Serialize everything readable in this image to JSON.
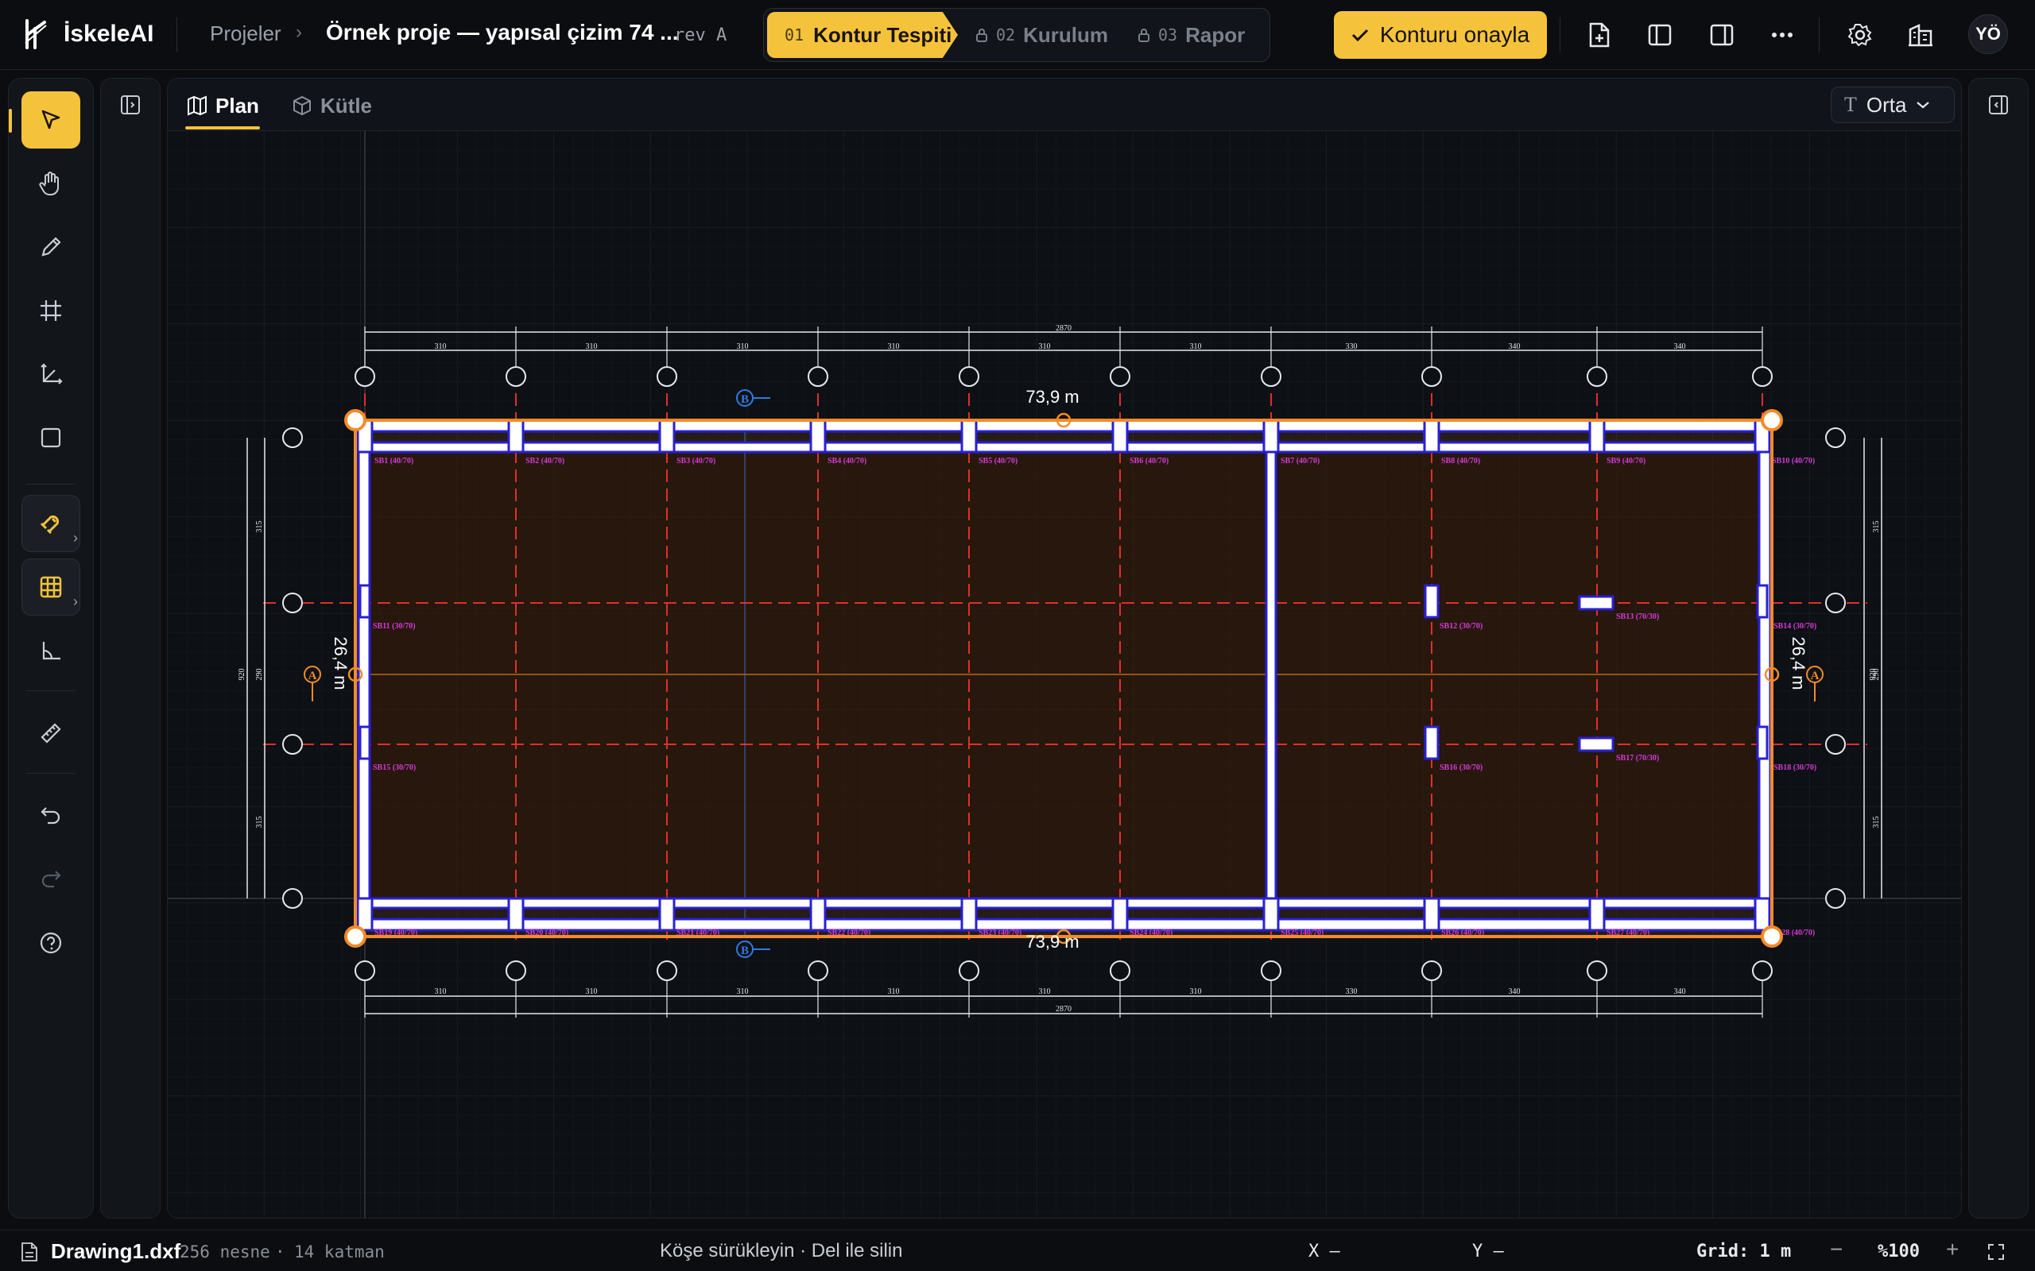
{
  "app": {
    "brand": "İskeleAI"
  },
  "breadcrumb": {
    "projects": "Projeler",
    "project_title": "Örnek proje — yapısal çizim 74 ...",
    "revision": "rev A"
  },
  "steps": [
    {
      "num": "01",
      "label": "Kontur Tespiti",
      "state": "active"
    },
    {
      "num": "02",
      "label": "Kurulum",
      "state": "locked"
    },
    {
      "num": "03",
      "label": "Rapor",
      "state": "locked"
    }
  ],
  "toolbar": {
    "confirm_label": "Konturu onayla",
    "avatar_initials": "YÖ"
  },
  "tabs": [
    {
      "label": "Plan",
      "icon": "map-icon",
      "active": true
    },
    {
      "label": "Kütle",
      "icon": "cube-icon",
      "active": false
    }
  ],
  "text_size": {
    "label": "Orta"
  },
  "drawing": {
    "dim_top": "73,9 m",
    "dim_bottom": "73,9 m",
    "dim_left": "26,4 m",
    "dim_right": "26,4 m",
    "section_b": "B",
    "section_a": "A",
    "overall_top": "2870",
    "overall_bottom": "2870",
    "spans_top": [
      "310",
      "310",
      "310",
      "310",
      "310",
      "310",
      "330",
      "340",
      "340"
    ],
    "spans_bottom": [
      "310",
      "310",
      "310",
      "310",
      "310",
      "310",
      "330",
      "340",
      "340"
    ],
    "side_spans": [
      "315",
      "290",
      "315"
    ],
    "side_total": "920",
    "beams_top": [
      "SB1 (40/70)",
      "SB2 (40/70)",
      "SB3 (40/70)",
      "SB4 (40/70)",
      "SB5 (40/70)",
      "SB6 (40/70)",
      "SB7 (40/70)",
      "SB8 (40/70)",
      "SB9 (40/70)",
      "SB10 (40/70)"
    ],
    "beams_bottom": [
      "SB19 (40/70)",
      "SB20 (40/70)",
      "SB21 (40/70)",
      "SB22 (40/70)",
      "SB23 (40/70)",
      "SB24 (40/70)",
      "SB25 (40/70)",
      "SB26 (40/70)",
      "SB27 (40/70)",
      "SB28 (40/70)"
    ],
    "beams_mid": [
      {
        "label": "SB11 (30/70)"
      },
      {
        "label": "SB12 (30/70)"
      },
      {
        "label": "SB13 (70/30)"
      },
      {
        "label": "SB14 (30/70)"
      },
      {
        "label": "SB15 (30/70)"
      },
      {
        "label": "SB16 (30/70)"
      },
      {
        "label": "SB17 (70/30)"
      },
      {
        "label": "SB18 (30/70)"
      }
    ]
  },
  "status": {
    "file": "Drawing1.dxf",
    "objects": "256 nesne",
    "layers": "14 katman",
    "hint": "Köşe sürükleyin · Del ile silin",
    "x": "X –",
    "y": "Y –",
    "grid": "Grid: 1 m",
    "zoom": "%100"
  },
  "colors": {
    "accent": "#f5c33b",
    "contour": "#f28c28",
    "axis": "#e0302a",
    "beam_label": "#d63ad6",
    "wall": "#2a1fd6"
  }
}
